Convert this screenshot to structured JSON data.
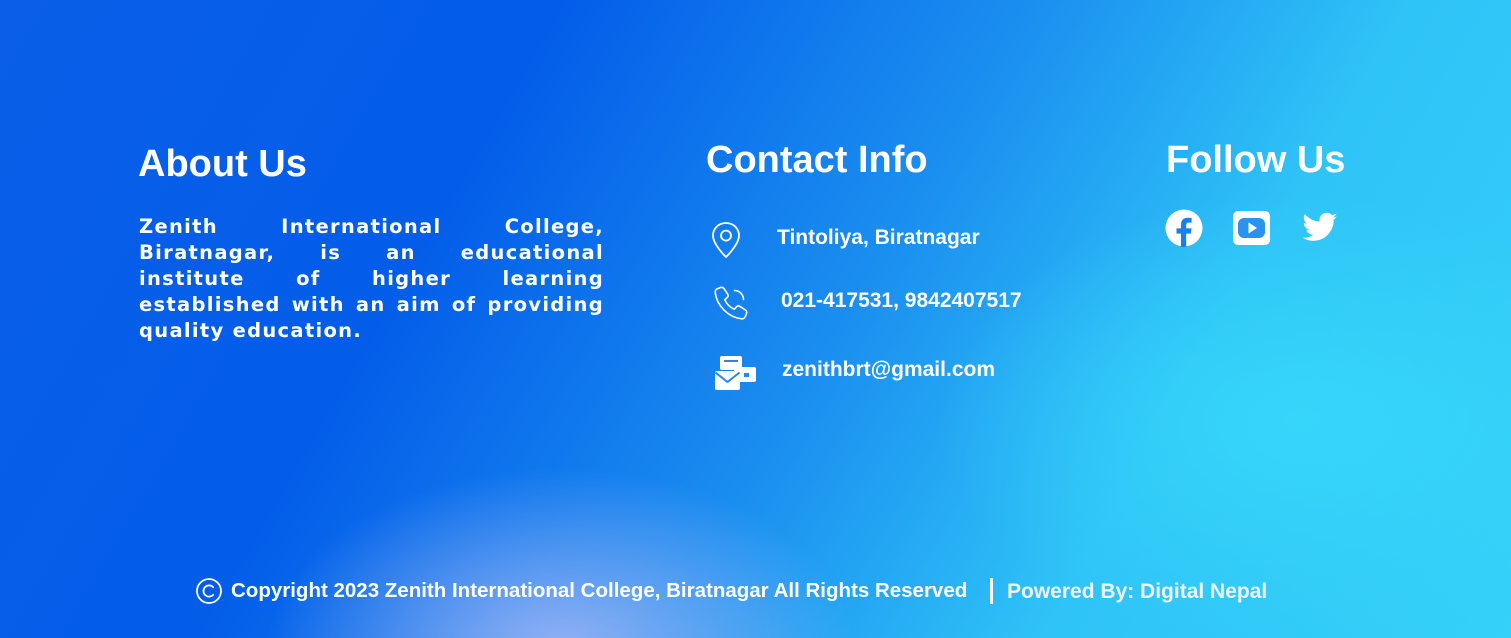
{
  "about": {
    "title": "About Us",
    "text": "Zenith International College, Biratnagar, is an educational institute of higher learning established with an aim of providing quality education."
  },
  "contact": {
    "title": "Contact Info",
    "address": "Tintoliya, Biratnagar",
    "phone": "021-417531, 9842407517",
    "email": "zenithbrt@gmail.com",
    "icons": [
      "location-pin-icon",
      "phone-icon",
      "mail-icon"
    ]
  },
  "follow": {
    "title": "Follow Us",
    "icons": [
      "facebook-icon",
      "youtube-icon",
      "twitter-icon"
    ]
  },
  "bottom": {
    "copyright": "Copyright 2023 Zenith International College, Biratnagar All Rights Reserved",
    "powered": "Powered By: Digital Nepal"
  },
  "colors": {
    "gradient_start": "#035de9",
    "gradient_end": "#35d1f9",
    "text": "#ffffff"
  }
}
